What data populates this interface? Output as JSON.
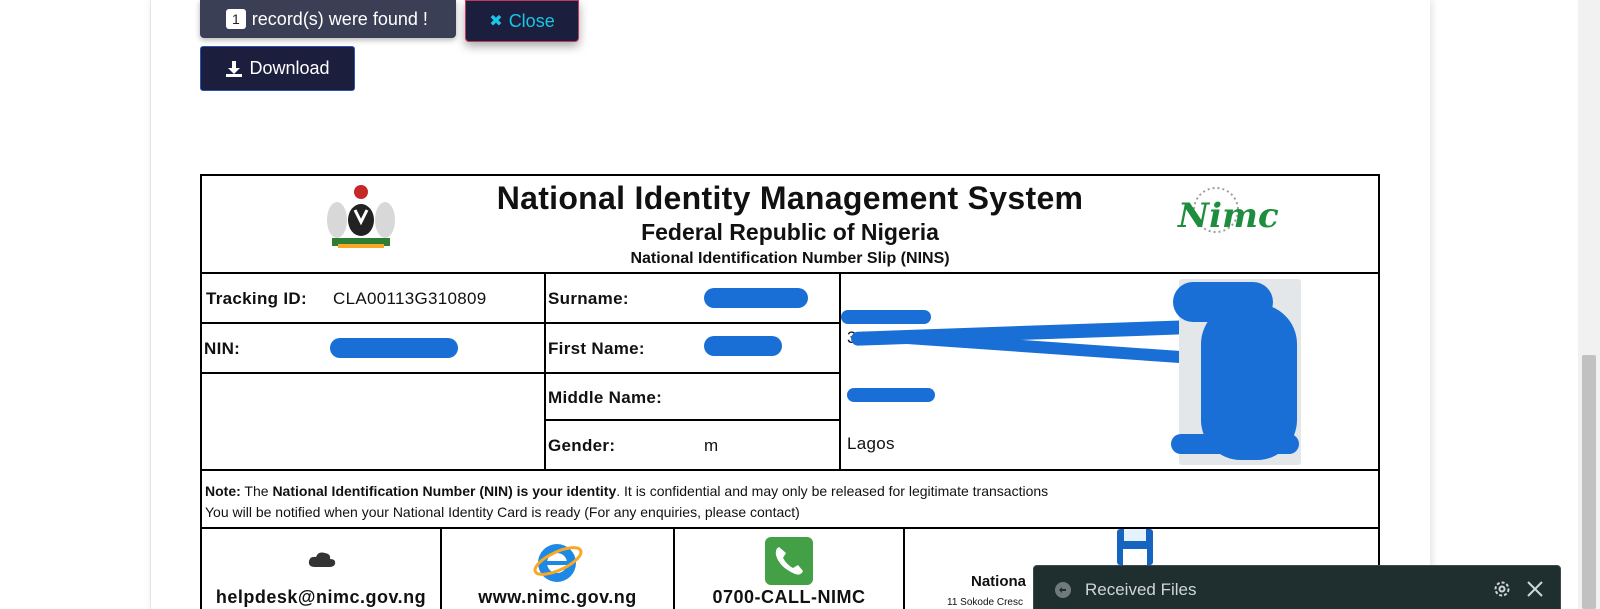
{
  "result_bar": {
    "count": "1",
    "found_text": "record(s) were found !",
    "close_label": "Close",
    "download_label": "Download"
  },
  "slip": {
    "title": "National Identity Management System",
    "subtitle": "Federal Republic of Nigeria",
    "slip_name": "National Identification Number Slip (NINS)",
    "tracking_label": "Tracking ID:",
    "tracking_value": "CLA00113G310809",
    "nin_label": "NIN:",
    "surname_label": "Surname:",
    "firstname_label": "First Name:",
    "middlename_label": "Middle Name:",
    "gender_label": "Gender:",
    "gender_value": "m",
    "address_partial": "34",
    "state_value": "Lagos",
    "note_label": "Note:",
    "note_pre": " The ",
    "note_bold": "National Identification Number (NIN) is your identity",
    "note_post": ". It is confidential and may only be released for legitimate transactions",
    "note_line2": "You will be notified when your National Identity Card is ready (For any enquiries, please contact)",
    "contacts": {
      "email": "helpdesk@nimc.gov.ng",
      "web": "www.nimc.gov.ng",
      "phone": "0700-CALL-NIMC",
      "office_name": "Nationa",
      "office_addr": "11 Sokode Cresc"
    },
    "nimc_logo_text": "Nimc"
  },
  "received_files": {
    "title": "Received Files"
  }
}
